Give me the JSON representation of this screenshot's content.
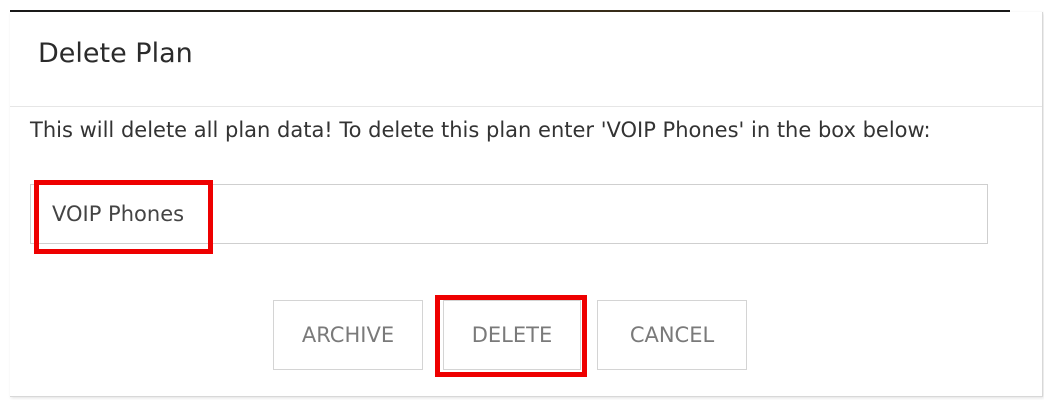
{
  "dialog": {
    "title": "Delete Plan",
    "message": "This will delete all plan data! To delete this plan enter 'VOIP Phones' in the box below:",
    "input_value": "VOIP Phones",
    "buttons": {
      "archive_label": "ARCHIVE",
      "delete_label": "DELETE",
      "cancel_label": "CANCEL"
    }
  },
  "colors": {
    "highlight": "#ee0000",
    "button_text": "#7a7a7a",
    "title_text": "#2b2b2b"
  }
}
